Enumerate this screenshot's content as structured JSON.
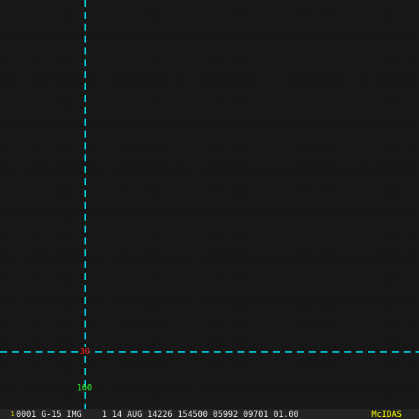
{
  "overlay": {
    "latitude_label": "30",
    "longitude_label": "160",
    "grid_color": "#00d8e8",
    "lat_color": "#ff2020",
    "lon_color": "#30ff30"
  },
  "status_bar": {
    "frame_number": "1",
    "info": "0001 G-15 IMG    1 14 AUG 14226 154500 05992 09701 01.00",
    "brand": "McIDAS"
  }
}
